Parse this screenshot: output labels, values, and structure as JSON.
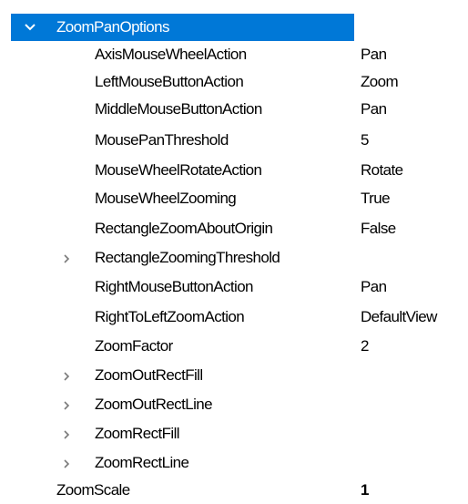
{
  "group": {
    "label": "ZoomPanOptions",
    "icon": "chevron-down-icon",
    "accent": "#0078d7"
  },
  "properties": [
    {
      "name": "AxisMouseWheelAction",
      "value": "Pan"
    },
    {
      "name": "LeftMouseButtonAction",
      "value": "Zoom"
    },
    {
      "name": "MiddleMouseButtonAction",
      "value": "Pan"
    },
    {
      "name": "MousePanThreshold",
      "value": "5"
    },
    {
      "name": "MouseWheelRotateAction",
      "value": "Rotate"
    },
    {
      "name": "MouseWheelZooming",
      "value": "True"
    },
    {
      "name": "RectangleZoomAboutOrigin",
      "value": "False"
    },
    {
      "name": "RectangleZoomingThreshold",
      "value": "",
      "expandable": true
    },
    {
      "name": "RightMouseButtonAction",
      "value": "Pan"
    },
    {
      "name": "RightToLeftZoomAction",
      "value": "DefaultView"
    },
    {
      "name": "ZoomFactor",
      "value": "2"
    },
    {
      "name": "ZoomOutRectFill",
      "value": "",
      "expandable": true
    },
    {
      "name": "ZoomOutRectLine",
      "value": "",
      "expandable": true
    },
    {
      "name": "ZoomRectFill",
      "value": "",
      "expandable": true
    },
    {
      "name": "ZoomRectLine",
      "value": "",
      "expandable": true
    }
  ],
  "zoom_scale": {
    "name": "ZoomScale",
    "value": "1"
  }
}
